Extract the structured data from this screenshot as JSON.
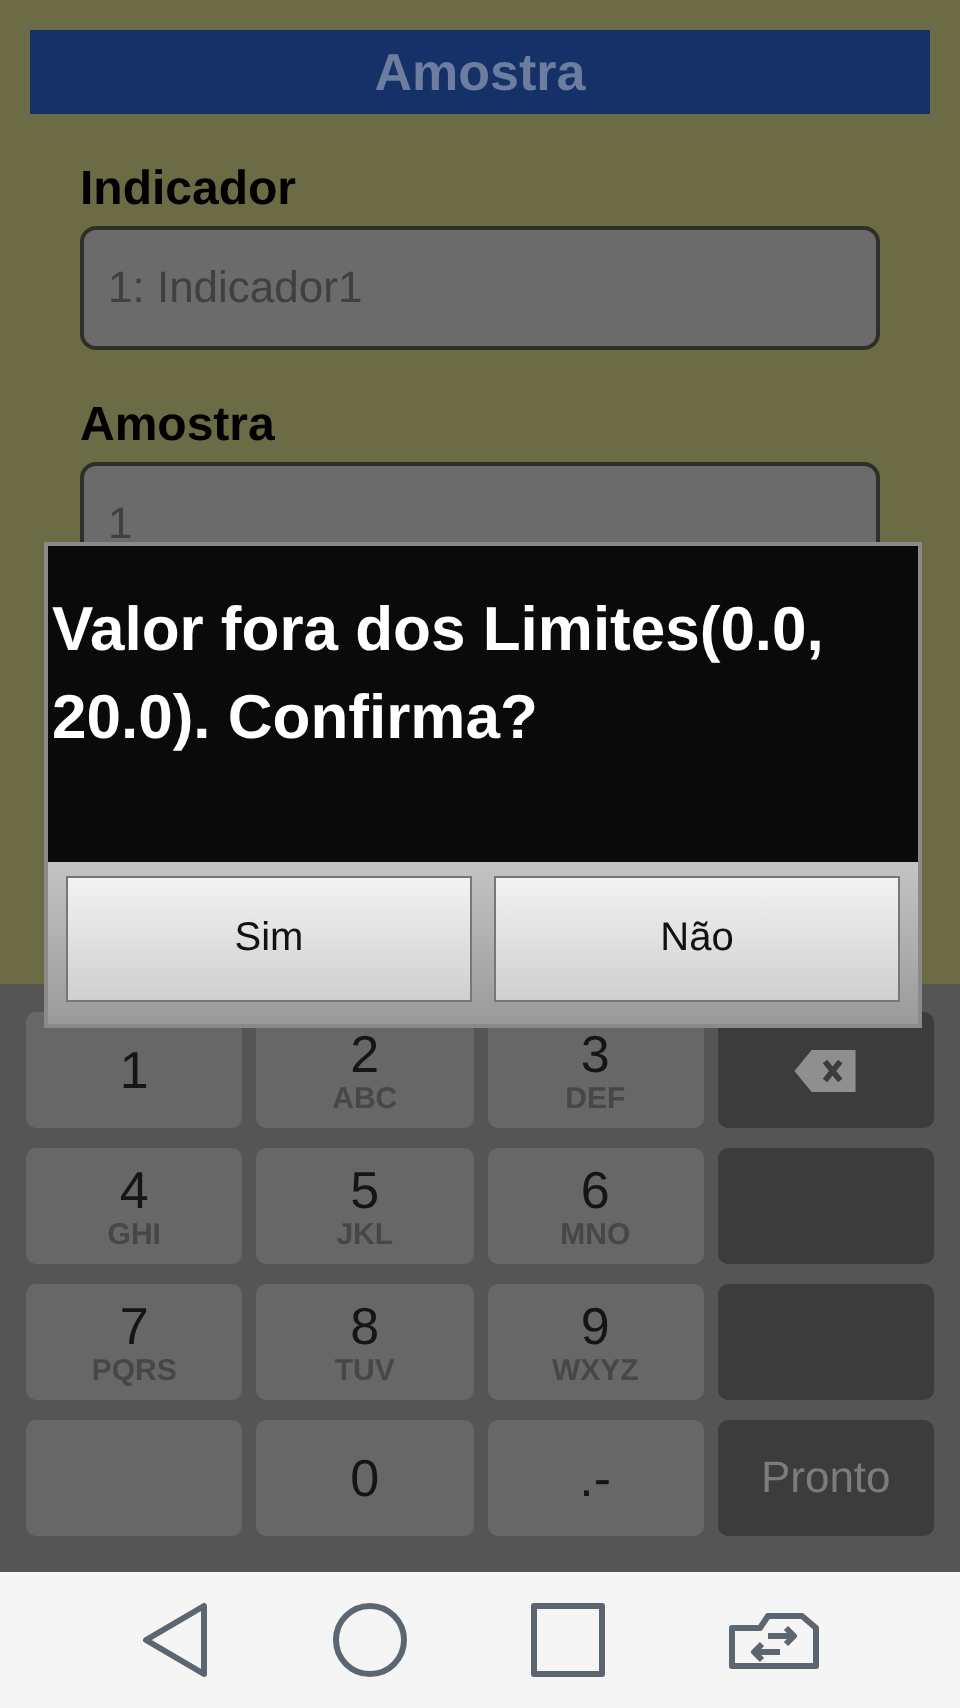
{
  "title_bar": {
    "title": "Amostra"
  },
  "form": {
    "fields": [
      {
        "label": "Indicador",
        "value": "1: Indicador1"
      },
      {
        "label": "Amostra",
        "value": "1"
      }
    ]
  },
  "dialog": {
    "message": "Valor fora dos Limites(0.0, 20.0). Confirma?",
    "buttons": [
      "Sim",
      "Não"
    ]
  },
  "keyboard": {
    "rows": [
      [
        {
          "kind": "digit",
          "digit": "1"
        },
        {
          "kind": "digit",
          "digit": "2",
          "letters": "ABC"
        },
        {
          "kind": "digit",
          "digit": "3",
          "letters": "DEF"
        },
        {
          "kind": "backspace"
        }
      ],
      [
        {
          "kind": "digit",
          "digit": "4",
          "letters": "GHI"
        },
        {
          "kind": "digit",
          "digit": "5",
          "letters": "JKL"
        },
        {
          "kind": "digit",
          "digit": "6",
          "letters": "MNO"
        },
        {
          "kind": "dark"
        }
      ],
      [
        {
          "kind": "digit",
          "digit": "7",
          "letters": "PQRS"
        },
        {
          "kind": "digit",
          "digit": "8",
          "letters": "TUV"
        },
        {
          "kind": "digit",
          "digit": "9",
          "letters": "WXYZ"
        },
        {
          "kind": "dark"
        }
      ],
      [
        {
          "kind": "blank"
        },
        {
          "kind": "digit",
          "digit": "0"
        },
        {
          "kind": "digit",
          "digit": ".-"
        },
        {
          "kind": "action",
          "label": "Pronto"
        }
      ]
    ]
  },
  "nav_bar": {
    "buttons": [
      {
        "kind": "back"
      },
      {
        "kind": "home"
      },
      {
        "kind": "recents"
      },
      {
        "kind": "switch"
      }
    ]
  }
}
